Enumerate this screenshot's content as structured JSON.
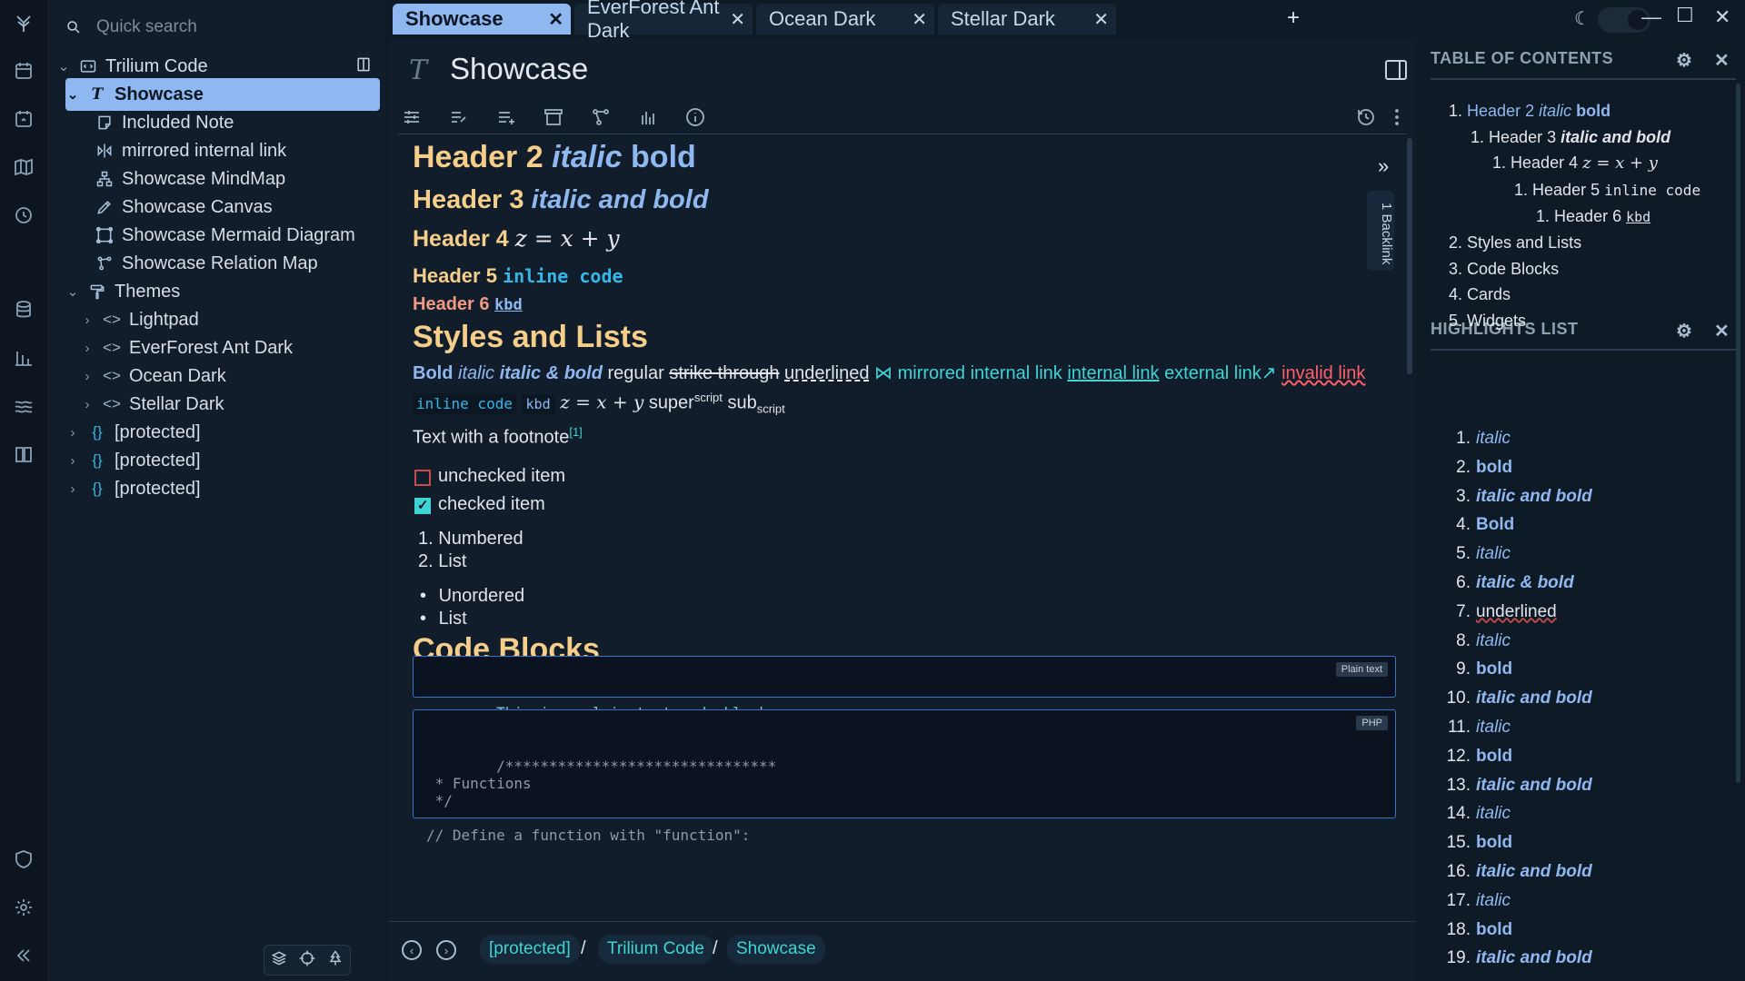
{
  "search": {
    "placeholder": "Quick search"
  },
  "tabs": [
    {
      "label": "Showcase"
    },
    {
      "label": "EverForest Ant Dark"
    },
    {
      "label": "Ocean Dark"
    },
    {
      "label": "Stellar Dark"
    }
  ],
  "tree": {
    "root": "Trilium Code",
    "items": [
      {
        "label": "Showcase"
      },
      {
        "label": "Included Note"
      },
      {
        "label": "mirrored internal link"
      },
      {
        "label": "Showcase MindMap"
      },
      {
        "label": "Showcase Canvas"
      },
      {
        "label": "Showcase Mermaid Diagram"
      },
      {
        "label": "Showcase Relation Map"
      },
      {
        "label": "Themes"
      },
      {
        "label": "Lightpad"
      },
      {
        "label": "EverForest Ant Dark"
      },
      {
        "label": "Ocean Dark"
      },
      {
        "label": "Stellar Dark"
      },
      {
        "label": "[protected]"
      },
      {
        "label": "[protected]"
      },
      {
        "label": "[protected]"
      }
    ]
  },
  "note": {
    "title": "Showcase",
    "backlink": "1 Backlink",
    "h2": {
      "text": "Header 2",
      "italic": "italic",
      "bold": "bold"
    },
    "h3": {
      "text": "Header 3",
      "italic_bold": "italic and bold"
    },
    "h4": {
      "text": "Header 4",
      "math": "z = x + y"
    },
    "h5": {
      "text": "Header 5",
      "code": "inline code"
    },
    "h6": {
      "text": "Header 6",
      "kbd": "kbd"
    },
    "styles_heading": "Styles and Lists",
    "styles": {
      "bold": "Bold",
      "italic": "italic",
      "italic_bold": "italic & bold",
      "regular": "regular",
      "strike": "strike through",
      "underlined": "underlined",
      "mirrored": "mirrored internal link",
      "internal": "internal link",
      "external": "external link↗",
      "invalid": "invalid link",
      "inline_code": "inline code",
      "kbd": "kbd",
      "math": "z = x + y",
      "super": "super",
      "super_sup": "script",
      "sub": "sub",
      "sub_sub": "script"
    },
    "footnote_text": "Text with a footnote",
    "footnote_ref": "[1]",
    "todo": [
      {
        "label": "unchecked item",
        "checked": false
      },
      {
        "label": "checked item",
        "checked": true
      }
    ],
    "numbered": [
      "Numbered",
      "List"
    ],
    "bullets": [
      "Unordered",
      "List"
    ],
    "code_heading": "Code Blocks",
    "code1": {
      "lang": "Plain text",
      "text": "This is a plain text code block"
    },
    "code2": {
      "lang": "PHP",
      "text": "/*******************************\n * Functions\n */\n\n// Define a function with \"function\":"
    }
  },
  "breadcrumb": [
    "[protected]",
    "Trilium Code",
    "Showcase"
  ],
  "toc": {
    "title": "TABLE OF CONTENTS",
    "items": [
      {
        "num": "1.",
        "text": "Header 2",
        "it": "italic",
        "b": "bold"
      },
      {
        "num": "1.",
        "text": "Header 3",
        "ib": "italic and bold"
      },
      {
        "num": "1.",
        "text": "Header 4",
        "math": "z = x + y"
      },
      {
        "num": "1.",
        "text": "Header 5",
        "code": "inline code"
      },
      {
        "num": "1.",
        "text": "Header 6",
        "kbd": "kbd"
      },
      {
        "num": "2.",
        "text": "Styles and Lists"
      },
      {
        "num": "3.",
        "text": "Code Blocks"
      },
      {
        "num": "4.",
        "text": "Cards"
      },
      {
        "num": "5.",
        "text": "Widgets"
      }
    ]
  },
  "highlights": {
    "title": "HIGHLIGHTS LIST",
    "items": [
      {
        "num": "1.",
        "text": "italic",
        "style": "i"
      },
      {
        "num": "2.",
        "text": "bold",
        "style": "b"
      },
      {
        "num": "3.",
        "text": "italic and bold",
        "style": "ib"
      },
      {
        "num": "4.",
        "text": "Bold",
        "style": "b"
      },
      {
        "num": "5.",
        "text": "italic",
        "style": "i"
      },
      {
        "num": "6.",
        "text": "italic & bold",
        "style": "ib"
      },
      {
        "num": "7.",
        "text": "underlined",
        "style": "u"
      },
      {
        "num": "8.",
        "text": "italic",
        "style": "i"
      },
      {
        "num": "9.",
        "text": "bold",
        "style": "b"
      },
      {
        "num": "10.",
        "text": "italic and bold",
        "style": "ib"
      },
      {
        "num": "11.",
        "text": "italic",
        "style": "i"
      },
      {
        "num": "12.",
        "text": "bold",
        "style": "b"
      },
      {
        "num": "13.",
        "text": "italic and bold",
        "style": "ib"
      },
      {
        "num": "14.",
        "text": "italic",
        "style": "i"
      },
      {
        "num": "15.",
        "text": "bold",
        "style": "b"
      },
      {
        "num": "16.",
        "text": "italic and bold",
        "style": "ib"
      },
      {
        "num": "17.",
        "text": "italic",
        "style": "i"
      },
      {
        "num": "18.",
        "text": "bold",
        "style": "b"
      },
      {
        "num": "19.",
        "text": "italic and bold",
        "style": "ib"
      }
    ]
  },
  "colors": {
    "accent": "#8fb8f0",
    "heading": "#f5cf8a",
    "link": "#3ed4d4",
    "error": "#ff5f66"
  }
}
